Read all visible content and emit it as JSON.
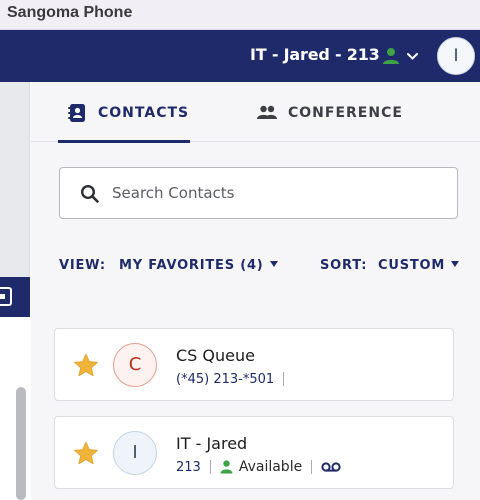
{
  "window": {
    "title": "Sangoma Phone"
  },
  "header": {
    "user_label": "IT - Jared - 213",
    "avatar_initial": "I",
    "colors": {
      "bar": "#1f2a6b",
      "presence": "#3ea346"
    }
  },
  "tabs": [
    {
      "label": "CONTACTS",
      "icon": "contacts-book-icon",
      "active": true
    },
    {
      "label": "CONFERENCE",
      "icon": "people-group-icon",
      "active": false
    }
  ],
  "search": {
    "placeholder": "Search Contacts",
    "value": ""
  },
  "view": {
    "label": "VIEW:",
    "value": "MY FAVORITES (4)"
  },
  "sort": {
    "label": "SORT:",
    "value": "CUSTOM"
  },
  "contacts": [
    {
      "favorite": true,
      "initial": "C",
      "name": "CS Queue",
      "number": "(*45) 213-*501"
    },
    {
      "favorite": true,
      "initial": "I",
      "name": "IT - Jared",
      "number": "213",
      "status": "Available",
      "voicemail_icon": "voicemail-icon"
    }
  ],
  "colors": {
    "accent": "#1f2a6b",
    "star": "#f0b43c",
    "available": "#3ea346"
  }
}
